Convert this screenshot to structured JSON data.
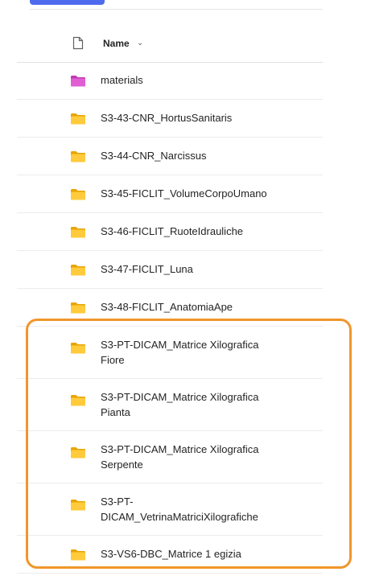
{
  "header": {
    "name_label": "Name",
    "sort_icon": "chevron-down-icon",
    "file_icon": "file-icon"
  },
  "colors": {
    "accent": "#4f6bed",
    "folder": "#ffcb3d",
    "special_folder": "#c239b3",
    "highlight": "#f0962b"
  },
  "rows": [
    {
      "label": "materials",
      "icon": "folder-icon",
      "color": "#c239b3"
    },
    {
      "label": "S3-43-CNR_HortusSanitaris",
      "icon": "folder-icon",
      "color": "#ffcb3d"
    },
    {
      "label": "S3-44-CNR_Narcissus",
      "icon": "folder-icon",
      "color": "#ffcb3d"
    },
    {
      "label": "S3-45-FICLIT_VolumeCorpoUmano",
      "icon": "folder-icon",
      "color": "#ffcb3d"
    },
    {
      "label": "S3-46-FICLIT_RuoteIdrauliche",
      "icon": "folder-icon",
      "color": "#ffcb3d"
    },
    {
      "label": "S3-47-FICLIT_Luna",
      "icon": "folder-icon",
      "color": "#ffcb3d"
    },
    {
      "label": "S3-48-FICLIT_AnatomiaApe",
      "icon": "folder-icon",
      "color": "#ffcb3d"
    },
    {
      "label": "S3-PT-DICAM_Matrice Xilografica\nFiore",
      "icon": "folder-icon",
      "color": "#ffcb3d"
    },
    {
      "label": "S3-PT-DICAM_Matrice Xilografica\nPianta",
      "icon": "folder-icon",
      "color": "#ffcb3d"
    },
    {
      "label": "S3-PT-DICAM_Matrice Xilografica\nSerpente",
      "icon": "folder-icon",
      "color": "#ffcb3d"
    },
    {
      "label": "S3-PT-\nDICAM_VetrinaMatriciXilografiche",
      "icon": "folder-icon",
      "color": "#ffcb3d"
    },
    {
      "label": "S3-VS6-DBC_Matrice 1 egizia",
      "icon": "folder-icon",
      "color": "#ffcb3d"
    }
  ]
}
